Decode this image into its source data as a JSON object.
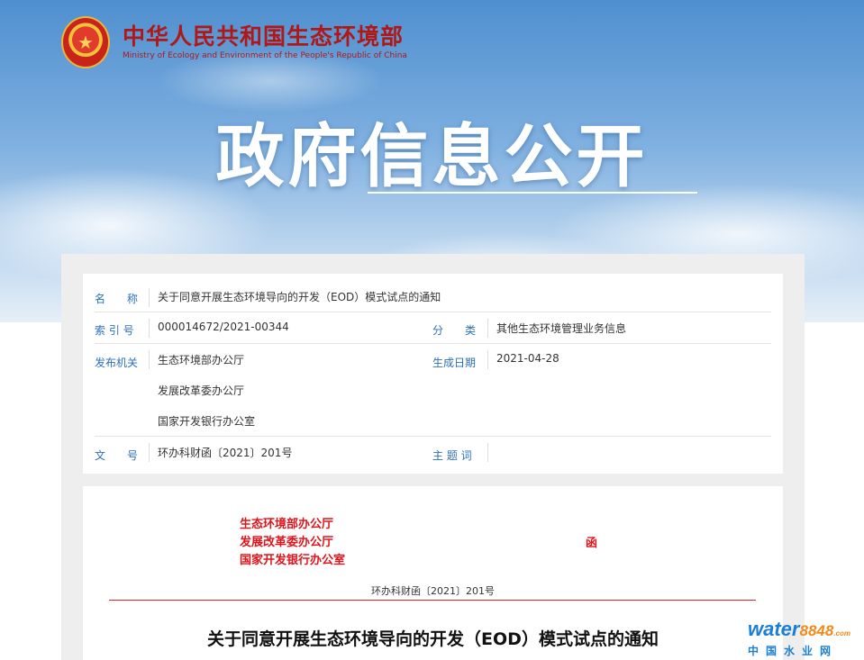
{
  "header": {
    "ministry_cn": "中华人民共和国生态环境部",
    "ministry_en": "Ministry of Ecology and Environment of the People's Republic of China",
    "emblem_icon": "national-emblem-icon",
    "banner_title": "政府信息公开"
  },
  "meta": {
    "name_label": "名　　称",
    "name_value": "关于同意开展生态环境导向的开发（EOD）模式试点的通知",
    "index_label": "索 引 号",
    "index_value": "000014672/2021-00344",
    "category_label": "分　　类",
    "category_value": "其他生态环境管理业务信息",
    "issuer_label": "发布机关",
    "issuers": [
      "生态环境部办公厅",
      "发展改革委办公厅",
      "国家开发银行办公室"
    ],
    "date_label": "生成日期",
    "date_value": "2021-04-28",
    "docno_label": "文　　号",
    "docno_value": "环办科财函〔2021〕201号",
    "keywords_label": "主 题 词",
    "keywords_value": ""
  },
  "document": {
    "issuers": [
      "生态环境部办公厅",
      "发展改革委办公厅",
      "国家开发银行办公室"
    ],
    "han": "函",
    "doc_number": "环办科财函〔2021〕201号",
    "title": "关于同意开展生态环境导向的开发（EOD）模式试点的通知"
  },
  "watermark": {
    "brand": "water",
    "number": "8848",
    "suffix": ".com",
    "cn": "中国水业网"
  },
  "colors": {
    "label_blue": "#2d6fb8",
    "ministry_red": "#b01818",
    "doc_red": "#e1141b"
  }
}
